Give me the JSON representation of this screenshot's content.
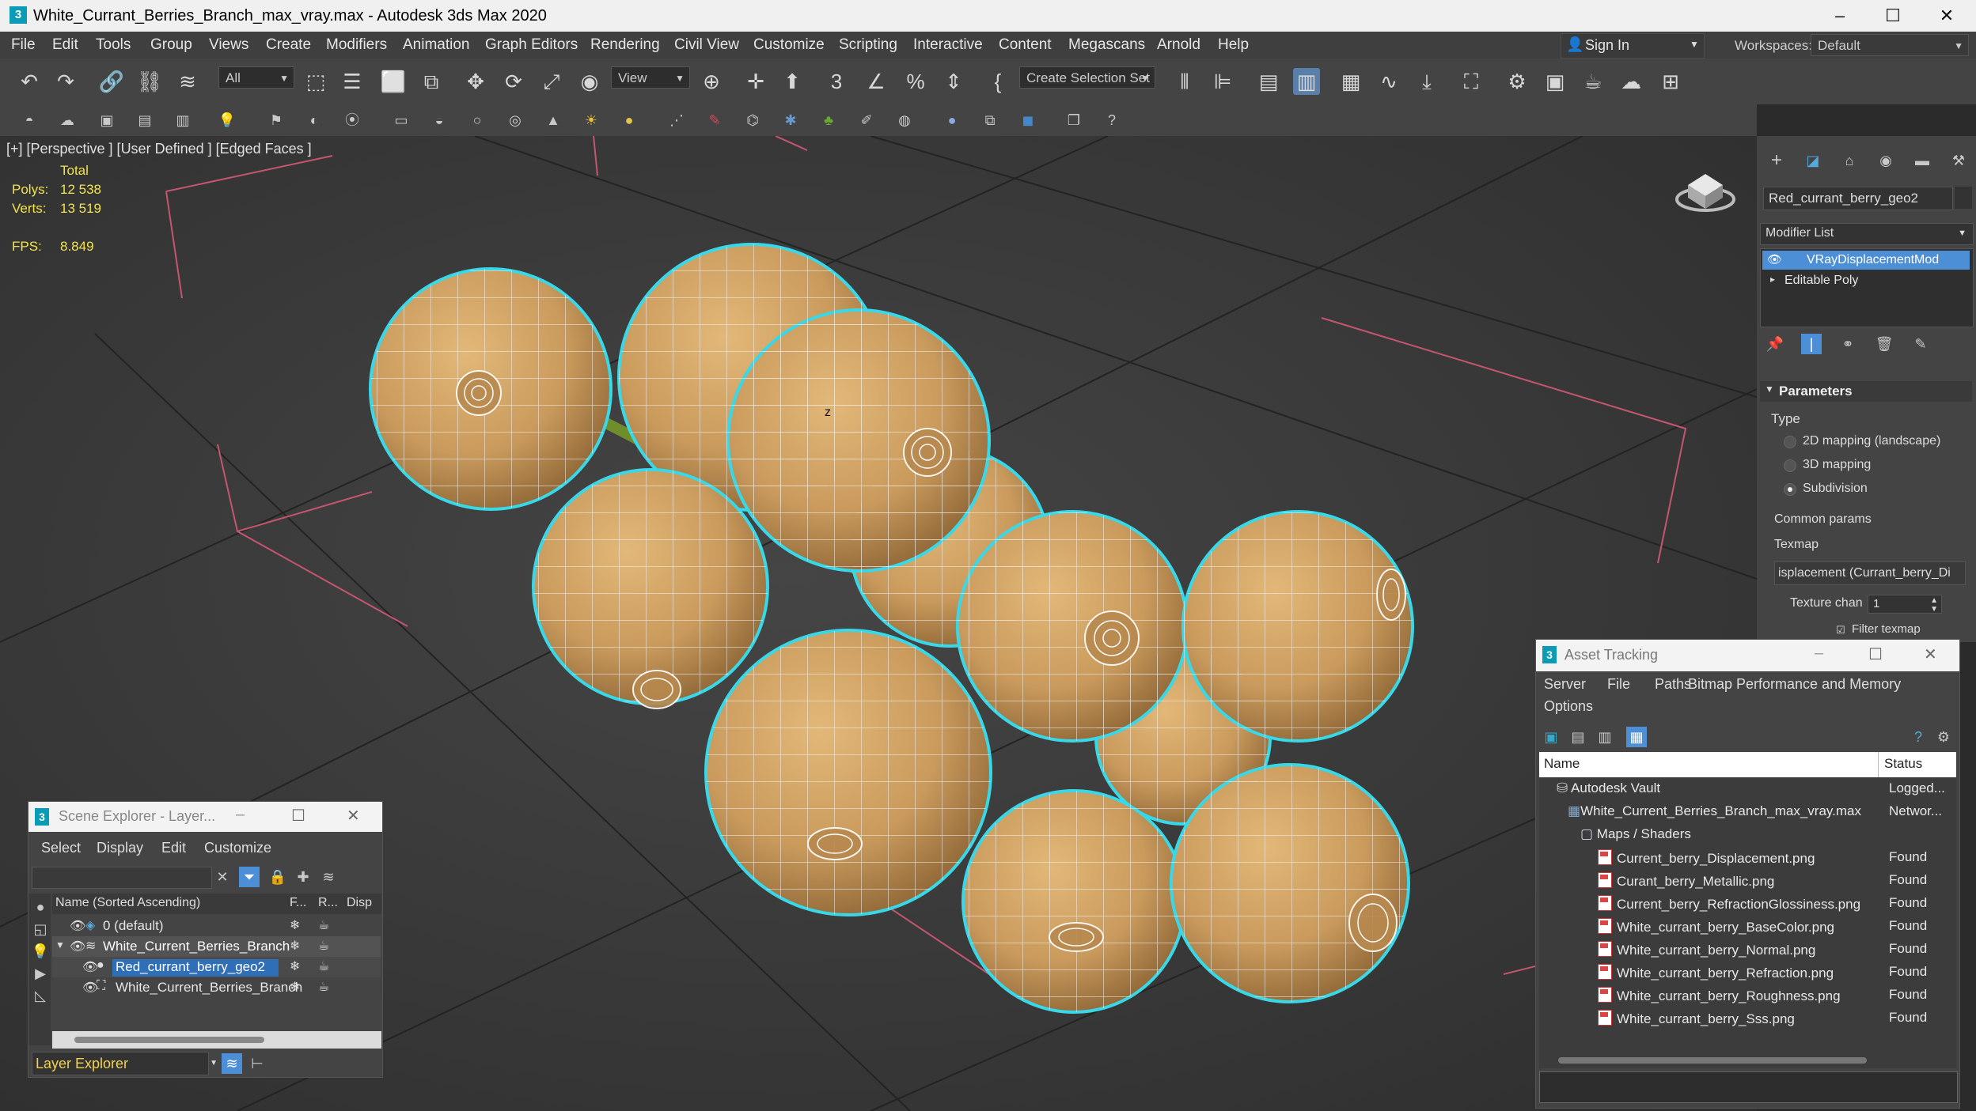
{
  "window": {
    "title": "White_Currant_Berries_Branch_max_vray.max - Autodesk 3ds Max 2020",
    "logo": "3"
  },
  "menu": [
    "File",
    "Edit",
    "Tools",
    "Group",
    "Views",
    "Create",
    "Modifiers",
    "Animation",
    "Graph Editors",
    "Rendering",
    "Civil View",
    "Customize",
    "Scripting",
    "Interactive",
    "Content",
    "Megascans",
    "Arnold",
    "Help"
  ],
  "signin": {
    "label": "Sign In"
  },
  "workspaces": {
    "label": "Workspaces:",
    "value": "Default"
  },
  "toolbar": {
    "filter_value": "All",
    "refcoord_value": "View",
    "selection_set_placeholder": "Create Selection Set"
  },
  "viewport": {
    "label": "[+] [Perspective ] [User Defined ] [Edged Faces ]",
    "stats": {
      "total_label": "Total",
      "polys_label": "Polys:",
      "polys_value": "12 538",
      "verts_label": "Verts:",
      "verts_value": "13 519",
      "fps_label": "FPS:",
      "fps_value": "8.849"
    },
    "axis_letter": "z"
  },
  "command_panel": {
    "object_name": "Red_currant_berry_geo2",
    "modifier_list": "Modifier List",
    "stack": [
      "VRayDisplacementMod",
      "Editable Poly"
    ],
    "parameters_title": "Parameters",
    "type_label": "Type",
    "types": [
      "2D mapping (landscape)",
      "3D mapping",
      "Subdivision"
    ],
    "selected_type": "Subdivision",
    "common_params": "Common params",
    "texmap_label": "Texmap",
    "texmap_value": "isplacement (Currant_berry_Di",
    "texture_chan_label": "Texture chan",
    "texture_chan_value": "1",
    "filter_texmap": "Filter texmap"
  },
  "asset_tracking": {
    "title": "Asset Tracking",
    "menus": [
      "Server",
      "File",
      "Paths",
      "Bitmap Performance and Memory",
      "Options"
    ],
    "col_name": "Name",
    "col_status": "Status",
    "rows": [
      {
        "name": "Autodesk Vault",
        "status": "Logged..."
      },
      {
        "name": "White_Current_Berries_Branch_max_vray.max",
        "status": "Networ..."
      },
      {
        "name": "Maps / Shaders",
        "status": ""
      },
      {
        "name": "Current_berry_Displacement.png",
        "status": "Found"
      },
      {
        "name": "Curant_berry_Metallic.png",
        "status": "Found"
      },
      {
        "name": "Current_berry_RefractionGlossiness.png",
        "status": "Found"
      },
      {
        "name": "White_currant_berry_BaseColor.png",
        "status": "Found"
      },
      {
        "name": "White_currant_berry_Normal.png",
        "status": "Found"
      },
      {
        "name": "White_currant_berry_Refraction.png",
        "status": "Found"
      },
      {
        "name": "White_currant_berry_Roughness.png",
        "status": "Found"
      },
      {
        "name": "White_currant_berry_Sss.png",
        "status": "Found"
      }
    ]
  },
  "scene_explorer": {
    "title": "Scene Explorer - Layer...",
    "menus": [
      "Select",
      "Display",
      "Edit",
      "Customize"
    ],
    "col_name": "Name (Sorted Ascending)",
    "col_f": "F...",
    "col_r": "R...",
    "col_disp": "Disp",
    "rows": [
      {
        "name": "0 (default)"
      },
      {
        "name": "White_Current_Berries_Branch"
      },
      {
        "name": "Red_currant_berry_geo2"
      },
      {
        "name": "White_Current_Berries_Branch"
      }
    ],
    "footer_label": "Layer Explorer"
  },
  "colors": {
    "accent": "#0a9bb6",
    "selection_outline": "#39d8e8",
    "stat_yellow": "#f2e34a",
    "berry": "#c99a5c"
  }
}
